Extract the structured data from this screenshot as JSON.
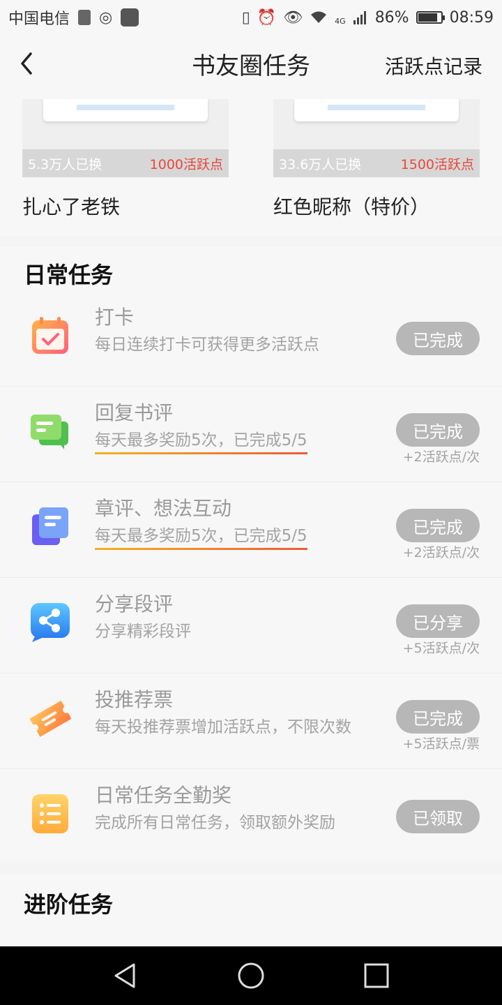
{
  "status_bar": {
    "carrier": "中国电信",
    "network": "4G",
    "battery": "86%",
    "battery_level": 0.86,
    "time": "08:59"
  },
  "header": {
    "title": "书友圈任务",
    "right_link": "活跃点记录"
  },
  "rewards": [
    {
      "count": "5.3万人已换",
      "cost": "1000活跃点",
      "name": "扎心了老铁"
    },
    {
      "count": "33.6万人已换",
      "cost": "1500活跃点",
      "name": "红色昵称（特价）"
    }
  ],
  "daily": {
    "title": "日常任务",
    "tasks": [
      {
        "name": "打卡",
        "desc": "每日连续打卡可获得更多活跃点",
        "button": "已完成",
        "points": "",
        "icon": "calendar-check-icon"
      },
      {
        "name": "回复书评",
        "desc": "每天最多奖励5次，已完成5/5",
        "button": "已完成",
        "points": "+2活跃点/次",
        "icon": "chat-bubble-icon"
      },
      {
        "name": "章评、想法互动",
        "desc": "每天最多奖励5次，已完成5/5",
        "button": "已完成",
        "points": "+2活跃点/次",
        "icon": "document-icon"
      },
      {
        "name": "分享段评",
        "desc": "分享精彩段评",
        "button": "已分享",
        "points": "+5活跃点/次",
        "icon": "share-icon"
      },
      {
        "name": "投推荐票",
        "desc": "每天投推荐票增加活跃点，不限次数",
        "button": "已完成",
        "points": "+5活跃点/票",
        "icon": "ticket-icon"
      },
      {
        "name": "日常任务全勤奖",
        "desc": "完成所有日常任务，领取额外奖励",
        "button": "已领取",
        "points": "",
        "icon": "list-icon"
      }
    ]
  },
  "advanced": {
    "title": "进阶任务"
  },
  "nav": {
    "back": "back-triangle-icon",
    "home": "home-circle-icon",
    "recents": "recents-square-icon"
  }
}
